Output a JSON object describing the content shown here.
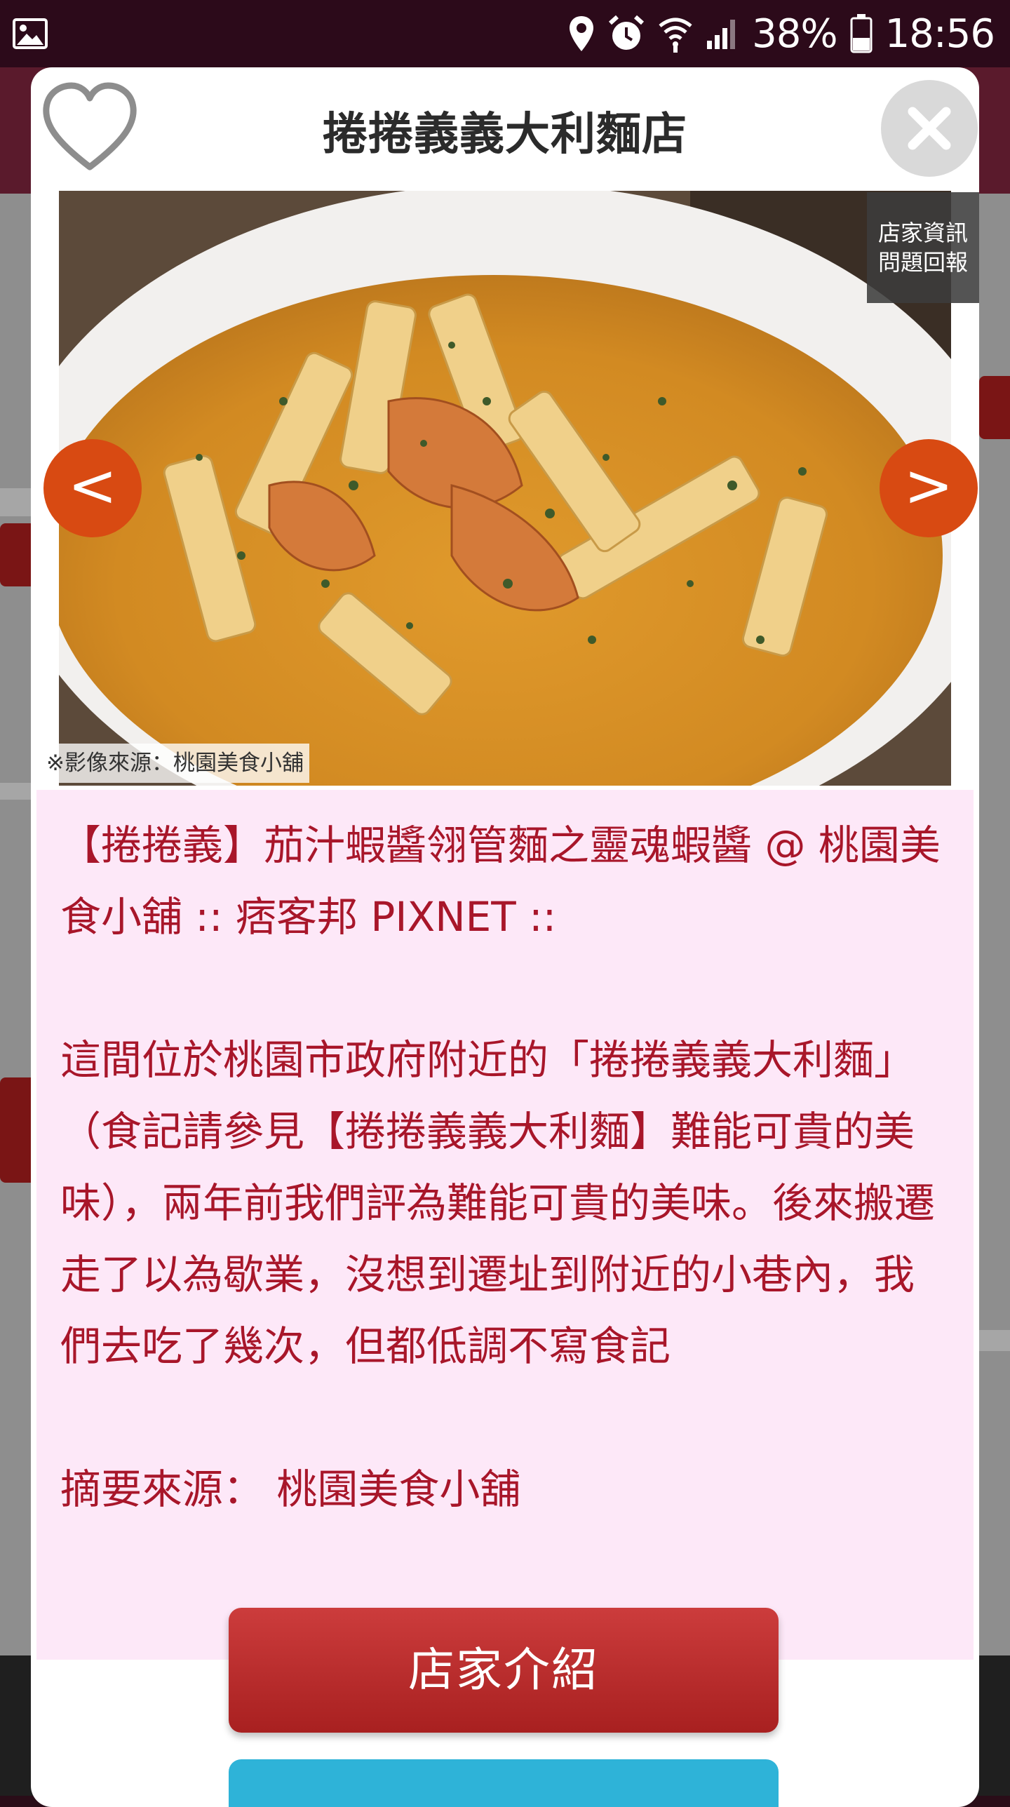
{
  "status_bar": {
    "battery_percent": "38%",
    "time": "18:56",
    "icons": [
      "gallery-icon",
      "location-icon",
      "alarm-icon",
      "wifi-icon",
      "signal-icon",
      "battery-icon"
    ]
  },
  "dialog": {
    "title": "捲捲義義大利麵店",
    "favorite_icon": "heart-outline-icon",
    "close_icon": "close-icon",
    "photo": {
      "caption": "※影像來源：桃園美食小舖",
      "report_line1": "店家資訊",
      "report_line2": "問題回報",
      "prev_label": "<",
      "next_label": ">"
    },
    "description": {
      "headline": "【捲捲義】茄汁蝦醬翎管麵之靈魂蝦醬 @ 桃園美食小舖 :: 痞客邦 PIXNET ::",
      "body": "這間位於桃園市政府附近的「捲捲義義大利麵」（食記請參見【捲捲義義大利麵】難能可貴的美味），兩年前我們評為難能可貴的美味。後來搬遷走了以為歇業，沒想到遷址到附近的小巷內，我們去吃了幾次，但都低調不寫食記",
      "source": "摘要來源： 桃園美食小舖"
    },
    "buttons": {
      "intro_label": "店家介紹"
    }
  },
  "colors": {
    "accent_red": "#a8162a",
    "desc_bg": "#fde8f8",
    "intro_button": "#b92a2a",
    "nav_arrow": "#d84a12",
    "second_button": "#2eb3d8"
  }
}
